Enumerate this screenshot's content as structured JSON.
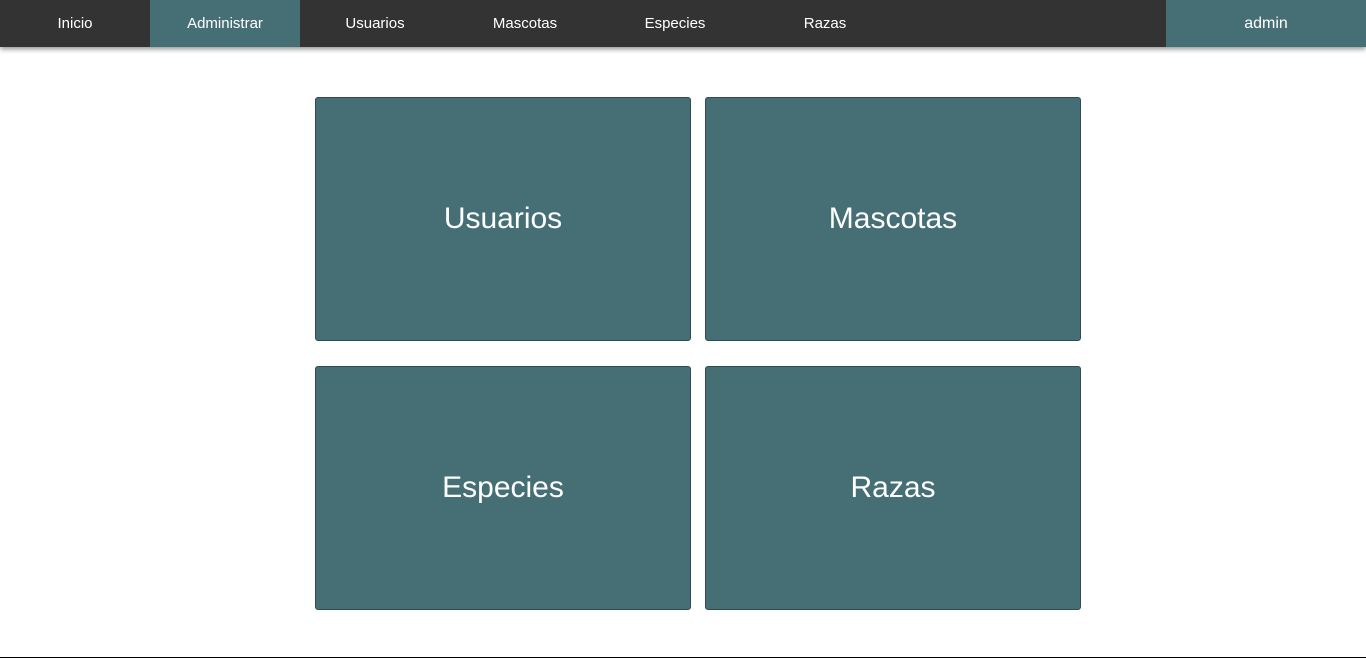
{
  "colors": {
    "navbar_bg": "#333333",
    "accent": "#456f74",
    "card_border": "#2f4d51",
    "text_light": "#ffffff",
    "page_bg": "#ffffff"
  },
  "nav": {
    "items": [
      {
        "label": "Inicio",
        "active": false
      },
      {
        "label": "Administrar",
        "active": true
      },
      {
        "label": "Usuarios",
        "active": false
      },
      {
        "label": "Mascotas",
        "active": false
      },
      {
        "label": "Especies",
        "active": false
      },
      {
        "label": "Razas",
        "active": false
      }
    ],
    "user_label": "admin"
  },
  "cards": [
    {
      "label": "Usuarios"
    },
    {
      "label": "Mascotas"
    },
    {
      "label": "Especies"
    },
    {
      "label": "Razas"
    }
  ]
}
